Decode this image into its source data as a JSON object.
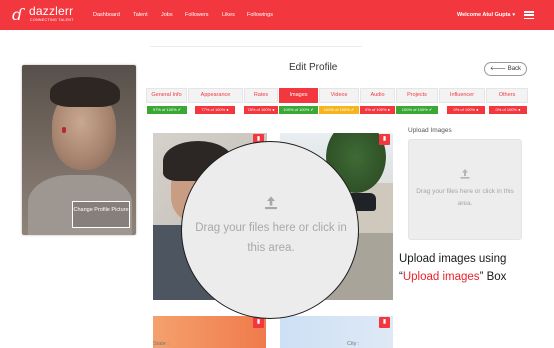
{
  "navbar": {
    "logo_name": "dazzlerr",
    "logo_tagline": "CONNECTING TALENT",
    "links": [
      "Dashboard",
      "Talent",
      "Jobs",
      "Followers",
      "Likes",
      "Followings"
    ],
    "welcome": "Welcome Atul Gupta"
  },
  "page": {
    "title": "Edit Profile",
    "back_label": "Back"
  },
  "profile": {
    "change_picture_label": "Change Profile Picture"
  },
  "tabs": [
    {
      "label": "General Info",
      "badge": "97% of 100%",
      "badge_color": "#3aa835",
      "active": false
    },
    {
      "label": "Appearance",
      "badge": "77% of 100%",
      "badge_color": "#f2373f",
      "active": false
    },
    {
      "label": "Rates",
      "badge": "78% of 100%",
      "badge_color": "#f2373f",
      "active": false
    },
    {
      "label": "Images",
      "badge": "100% of 100%",
      "badge_color": "#3aa835",
      "active": true
    },
    {
      "label": "Videos",
      "badge": "100% of 100%",
      "badge_color": "#f5b51e",
      "active": false
    },
    {
      "label": "Audio",
      "badge": "0% of 100%",
      "badge_color": "#f2373f",
      "active": false
    },
    {
      "label": "Projects",
      "badge": "100% of 100%",
      "badge_color": "#3aa835",
      "active": false
    },
    {
      "label": "Influencer",
      "badge": "0% of 100%",
      "badge_color": "#f2373f",
      "active": false
    },
    {
      "label": "Others",
      "badge": "0% of 100%",
      "badge_color": "#f2373f",
      "active": false
    }
  ],
  "upload": {
    "title": "Upload Images",
    "dropzone_text": "Drag your files here or click in this area.",
    "magnified_text": "Drag your files here or click in this area."
  },
  "form": {
    "state_label": "State :",
    "city_label": "City :"
  },
  "caption": {
    "line1": "Upload images using",
    "quote_open": "“",
    "highlight": "Upload images",
    "quote_close": "”",
    "line2_end": " Box"
  },
  "colors": {
    "brand": "#f2373f",
    "complete": "#3aa835",
    "partial": "#f5b51e"
  },
  "icons": {
    "delete": "trash-icon",
    "upload": "upload-icon",
    "menu": "hamburger-icon"
  }
}
